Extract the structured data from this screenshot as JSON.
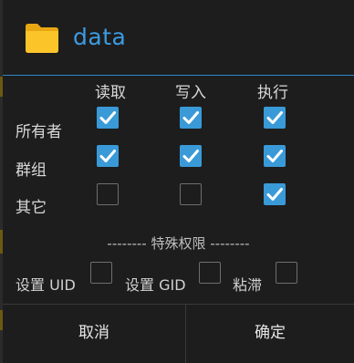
{
  "dialog": {
    "title": "data",
    "folder_icon": "folder-icon",
    "accent_color": "#3d9be3"
  },
  "columns": [
    "读取",
    "写入",
    "执行"
  ],
  "rows": [
    {
      "label": "所有者",
      "read": true,
      "write": true,
      "execute": true
    },
    {
      "label": "群组",
      "read": true,
      "write": true,
      "execute": true
    },
    {
      "label": "其它",
      "read": false,
      "write": false,
      "execute": true
    }
  ],
  "special": {
    "title": "-------- 特殊权限 --------",
    "items": [
      {
        "label": "设置 UID",
        "checked": false
      },
      {
        "label": "设置 GID",
        "checked": false
      },
      {
        "label": "粘滞",
        "checked": false
      }
    ]
  },
  "buttons": {
    "cancel": "取消",
    "confirm": "确定"
  }
}
